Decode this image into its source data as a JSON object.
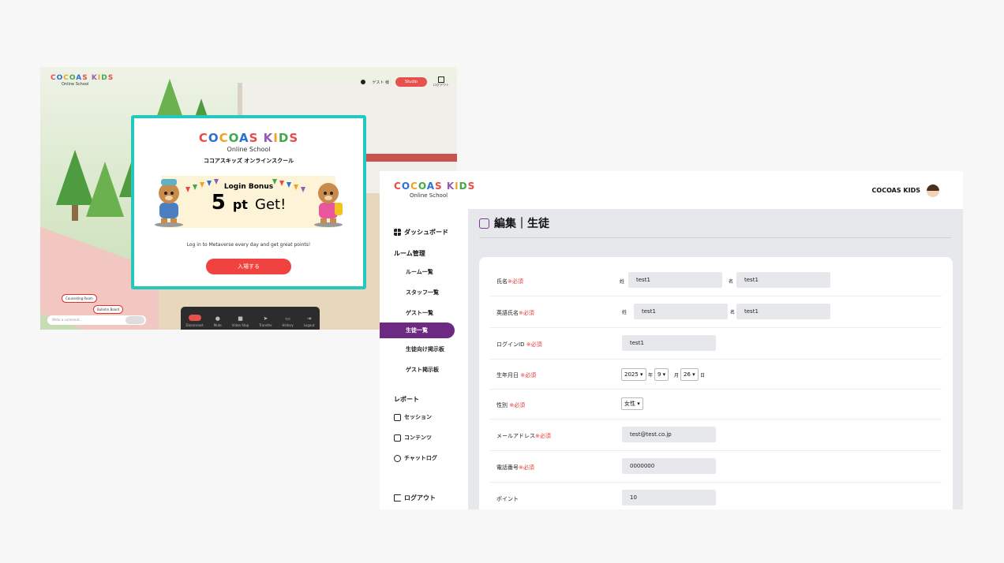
{
  "meta": {
    "logo_text": "COCOAS KIDS",
    "logo_sub": "Online School",
    "topbar_label": "ゲスト 様",
    "topbar_button": "Studio",
    "topbar_logout": "ログアウト",
    "bottom_toolbar": [
      "Disconnect",
      "Mute",
      "Video Stop",
      "Transfer",
      "History",
      "Logout"
    ],
    "chat_placeholder": "Write a comment...",
    "bubble_1": "Counseling Room",
    "bubble_2": "Bulletin Board",
    "popup": {
      "brand": "COCOAS KIDS",
      "online": "Online School",
      "kana": "ココアスキッズ オンラインスクール",
      "bonus_label": "Login Bonus",
      "points": "5",
      "pt": "pt",
      "get": "Get!",
      "description": "Log in to Metaverse every day and get great points!",
      "enter_button": "入場する"
    }
  },
  "admin": {
    "brand": "COCOAS KIDS",
    "online": "Online School",
    "user_name": "COCOAS KIDS",
    "sidebar": {
      "dashboard": "ダッシュボード",
      "room_mgmt": "ルーム管理",
      "room_list": "ルーム一覧",
      "staff_list": "スタッフ一覧",
      "guest_list": "ゲスト一覧",
      "student_list": "生徒一覧",
      "student_board": "生徒向け掲示板",
      "guest_board": "ゲスト掲示板",
      "report": "レポート",
      "session": "セッション",
      "contents": "コンテンツ",
      "chatlog": "チャットログ",
      "logout": "ログアウト"
    },
    "page_title": "編集｜生徒",
    "required": "※必須",
    "form": {
      "name_label": "氏名",
      "last_name_prefix": "姓",
      "first_name_prefix": "名",
      "last_name": "test1",
      "first_name": "test1",
      "en_name_label": "英語氏名",
      "en_last_name": "test1",
      "en_first_name": "test1",
      "login_label": "ログインID",
      "login_id": "test1",
      "birth_label": "生年月日",
      "year": "2025 ▾",
      "year_unit": "年",
      "month": "9 ▾",
      "month_unit": "月",
      "day": "26 ▾",
      "day_unit": "日",
      "gender_label": "性別",
      "gender": "女性 ▾",
      "email_label": "メールアドレス",
      "email": "test@test.co.jp",
      "phone_label": "電話番号",
      "phone": "0000000",
      "points_label": "ポイント",
      "points": "10"
    }
  }
}
